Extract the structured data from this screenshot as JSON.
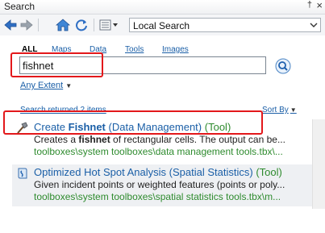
{
  "window": {
    "title": "Search",
    "pin_glyph": "†",
    "close_glyph": "×"
  },
  "toolbar": {
    "icons": [
      "back-arrow-icon",
      "forward-arrow-icon",
      "home-icon",
      "refresh-icon",
      "view-options-icon"
    ],
    "scope": "Local Search"
  },
  "categories": [
    {
      "label": "ALL",
      "active": true
    },
    {
      "label": "Maps",
      "active": false
    },
    {
      "label": "Data",
      "active": false
    },
    {
      "label": "Tools",
      "active": false
    },
    {
      "label": "Images",
      "active": false
    }
  ],
  "search": {
    "value": "fishnet",
    "placeholder": ""
  },
  "extent": {
    "label": "Any Extent"
  },
  "status": {
    "label": "Search returned 2 items",
    "sort_label": "Sort By"
  },
  "results": [
    {
      "title": "Create",
      "title_bold": "Fishnet",
      "toolbox": "(Data Management)",
      "type": "(Tool)",
      "desc_pre": "Creates a ",
      "desc_bold": "fishnet",
      "desc_post": " of rectangular cells. The output can be...",
      "path": "toolboxes\\system toolboxes\\data management tools.tbx\\..."
    },
    {
      "title": "Optimized Hot Spot Analysis",
      "title_bold": "",
      "toolbox": "(Spatial Statistics)",
      "type": "(Tool)",
      "desc_pre": "Given incident points or weighted features (points or poly...",
      "desc_bold": "",
      "desc_post": "",
      "path": "toolboxes\\system toolboxes\\spatial statistics tools.tbx\\m..."
    }
  ],
  "colors": {
    "link": "#1b5fa7",
    "tool_green": "#2e8b2e",
    "highlight_red": "#e3181b"
  }
}
